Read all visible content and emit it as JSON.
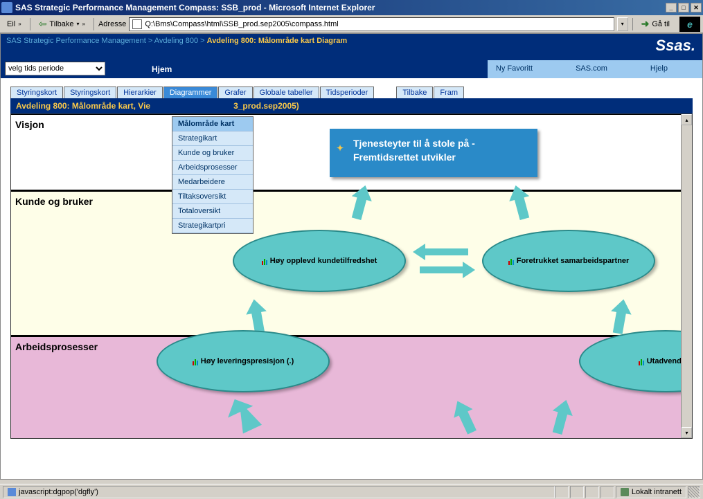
{
  "window": {
    "title": "SAS Strategic Performance Management Compass: SSB_prod - Microsoft Internet Explorer"
  },
  "toolbar": {
    "file": "Eil",
    "back": "Tilbake",
    "address_label": "Adresse",
    "address_value": "Q:\\Bms\\Compass\\html\\SSB_prod.sep2005\\compass.html",
    "go": "Gå til"
  },
  "breadcrumb": {
    "root": "SAS Strategic Performance Management",
    "level1": "Avdeling 800",
    "current": "Avdeling 800: Målområde kart Diagram"
  },
  "nav": {
    "period_placeholder": "velg tids periode",
    "home": "Hjem",
    "favorite": "Ny Favoritt",
    "sas": "SAS.com",
    "help": "Hjelp"
  },
  "tabs": {
    "items": [
      "Styringskort",
      "Styringskort",
      "Hierarkier",
      "Diagrammer",
      "Grafer",
      "Globale tabeller",
      "Tidsperioder"
    ],
    "nav": [
      "Tilbake",
      "Fram"
    ],
    "active_index": 3
  },
  "dropdown": {
    "items": [
      "Målområde kart",
      "Strategikart",
      "Kunde og bruker",
      "Arbeidsprosesser",
      "Medarbeidere",
      "Tiltaksoversikt",
      "Totaloversikt",
      "Strategikartpri"
    ],
    "selected_index": 0
  },
  "context": {
    "text": "Avdeling 800: Målområde kart, Vie",
    "text_tail": "3_prod.sep2005)"
  },
  "diagram": {
    "bands": {
      "visjon": "Visjon",
      "kunde": "Kunde og bruker",
      "arbeid": "Arbeidsprosesser"
    },
    "vision_line1": "Tjenesteyter til å stole på -",
    "vision_line2": "Fremtidsrettet utvikler",
    "nodes": {
      "kundetilfredshet": "Høy opplevd kundetilfredshet",
      "samarbeidspartner": "Foretrukket samarbeidspartner",
      "leveringspresisjon": "Høy leveringspresisjon (.)",
      "utadvendt": "Utadvendt fa"
    }
  },
  "status": {
    "left": "javascript:dgpop('dgfly')",
    "zone": "Lokalt intranett"
  },
  "logo": {
    "sas": "Ssas."
  }
}
